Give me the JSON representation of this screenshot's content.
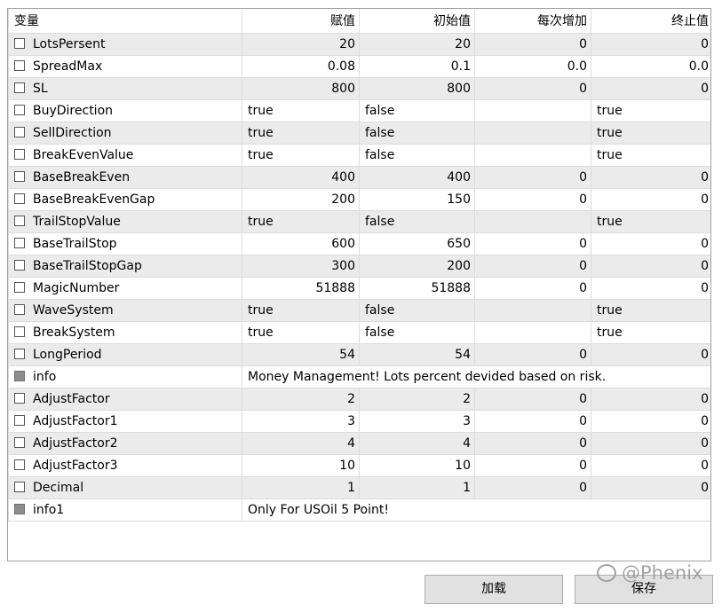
{
  "columns": {
    "variable": "变量",
    "value": "赋值",
    "start": "初始值",
    "step": "每次增加",
    "stop": "终止值"
  },
  "rows": [
    {
      "name": "LotsPersent",
      "value": "20",
      "start": "20",
      "step": "0",
      "stop": "0",
      "kind": "num"
    },
    {
      "name": "SpreadMax",
      "value": "0.08",
      "start": "0.1",
      "step": "0.0",
      "stop": "0.0",
      "kind": "num"
    },
    {
      "name": "SL",
      "value": "800",
      "start": "800",
      "step": "0",
      "stop": "0",
      "kind": "num"
    },
    {
      "name": "BuyDirection",
      "value": "true",
      "start": "false",
      "step": "",
      "stop": "true",
      "kind": "bool"
    },
    {
      "name": "SellDirection",
      "value": "true",
      "start": "false",
      "step": "",
      "stop": "true",
      "kind": "bool"
    },
    {
      "name": "BreakEvenValue",
      "value": "true",
      "start": "false",
      "step": "",
      "stop": "true",
      "kind": "bool"
    },
    {
      "name": "BaseBreakEven",
      "value": "400",
      "start": "400",
      "step": "0",
      "stop": "0",
      "kind": "num"
    },
    {
      "name": "BaseBreakEvenGap",
      "value": "200",
      "start": "150",
      "step": "0",
      "stop": "0",
      "kind": "num"
    },
    {
      "name": "TrailStopValue",
      "value": "true",
      "start": "false",
      "step": "",
      "stop": "true",
      "kind": "bool"
    },
    {
      "name": "BaseTrailStop",
      "value": "600",
      "start": "650",
      "step": "0",
      "stop": "0",
      "kind": "num"
    },
    {
      "name": "BaseTrailStopGap",
      "value": "300",
      "start": "200",
      "step": "0",
      "stop": "0",
      "kind": "num"
    },
    {
      "name": "MagicNumber",
      "value": "51888",
      "start": "51888",
      "step": "0",
      "stop": "0",
      "kind": "num"
    },
    {
      "name": "WaveSystem",
      "value": "true",
      "start": "false",
      "step": "",
      "stop": "true",
      "kind": "bool"
    },
    {
      "name": "BreakSystem",
      "value": "true",
      "start": "false",
      "step": "",
      "stop": "true",
      "kind": "bool"
    },
    {
      "name": "LongPeriod",
      "value": "54",
      "start": "54",
      "step": "0",
      "stop": "0",
      "kind": "num"
    },
    {
      "name": "info",
      "value": "Money Management! Lots percent devided based on risk.",
      "kind": "info"
    },
    {
      "name": "AdjustFactor",
      "value": "2",
      "start": "2",
      "step": "0",
      "stop": "0",
      "kind": "num"
    },
    {
      "name": "AdjustFactor1",
      "value": "3",
      "start": "3",
      "step": "0",
      "stop": "0",
      "kind": "num"
    },
    {
      "name": "AdjustFactor2",
      "value": "4",
      "start": "4",
      "step": "0",
      "stop": "0",
      "kind": "num"
    },
    {
      "name": "AdjustFactor3",
      "value": "10",
      "start": "10",
      "step": "0",
      "stop": "0",
      "kind": "num"
    },
    {
      "name": "Decimal",
      "value": "1",
      "start": "1",
      "step": "0",
      "stop": "0",
      "kind": "num"
    },
    {
      "name": "info1",
      "value": "Only For USOil 5 Point!",
      "kind": "info"
    }
  ],
  "buttons": {
    "load": "加载",
    "save": "保存"
  },
  "watermark": "@Phenix"
}
